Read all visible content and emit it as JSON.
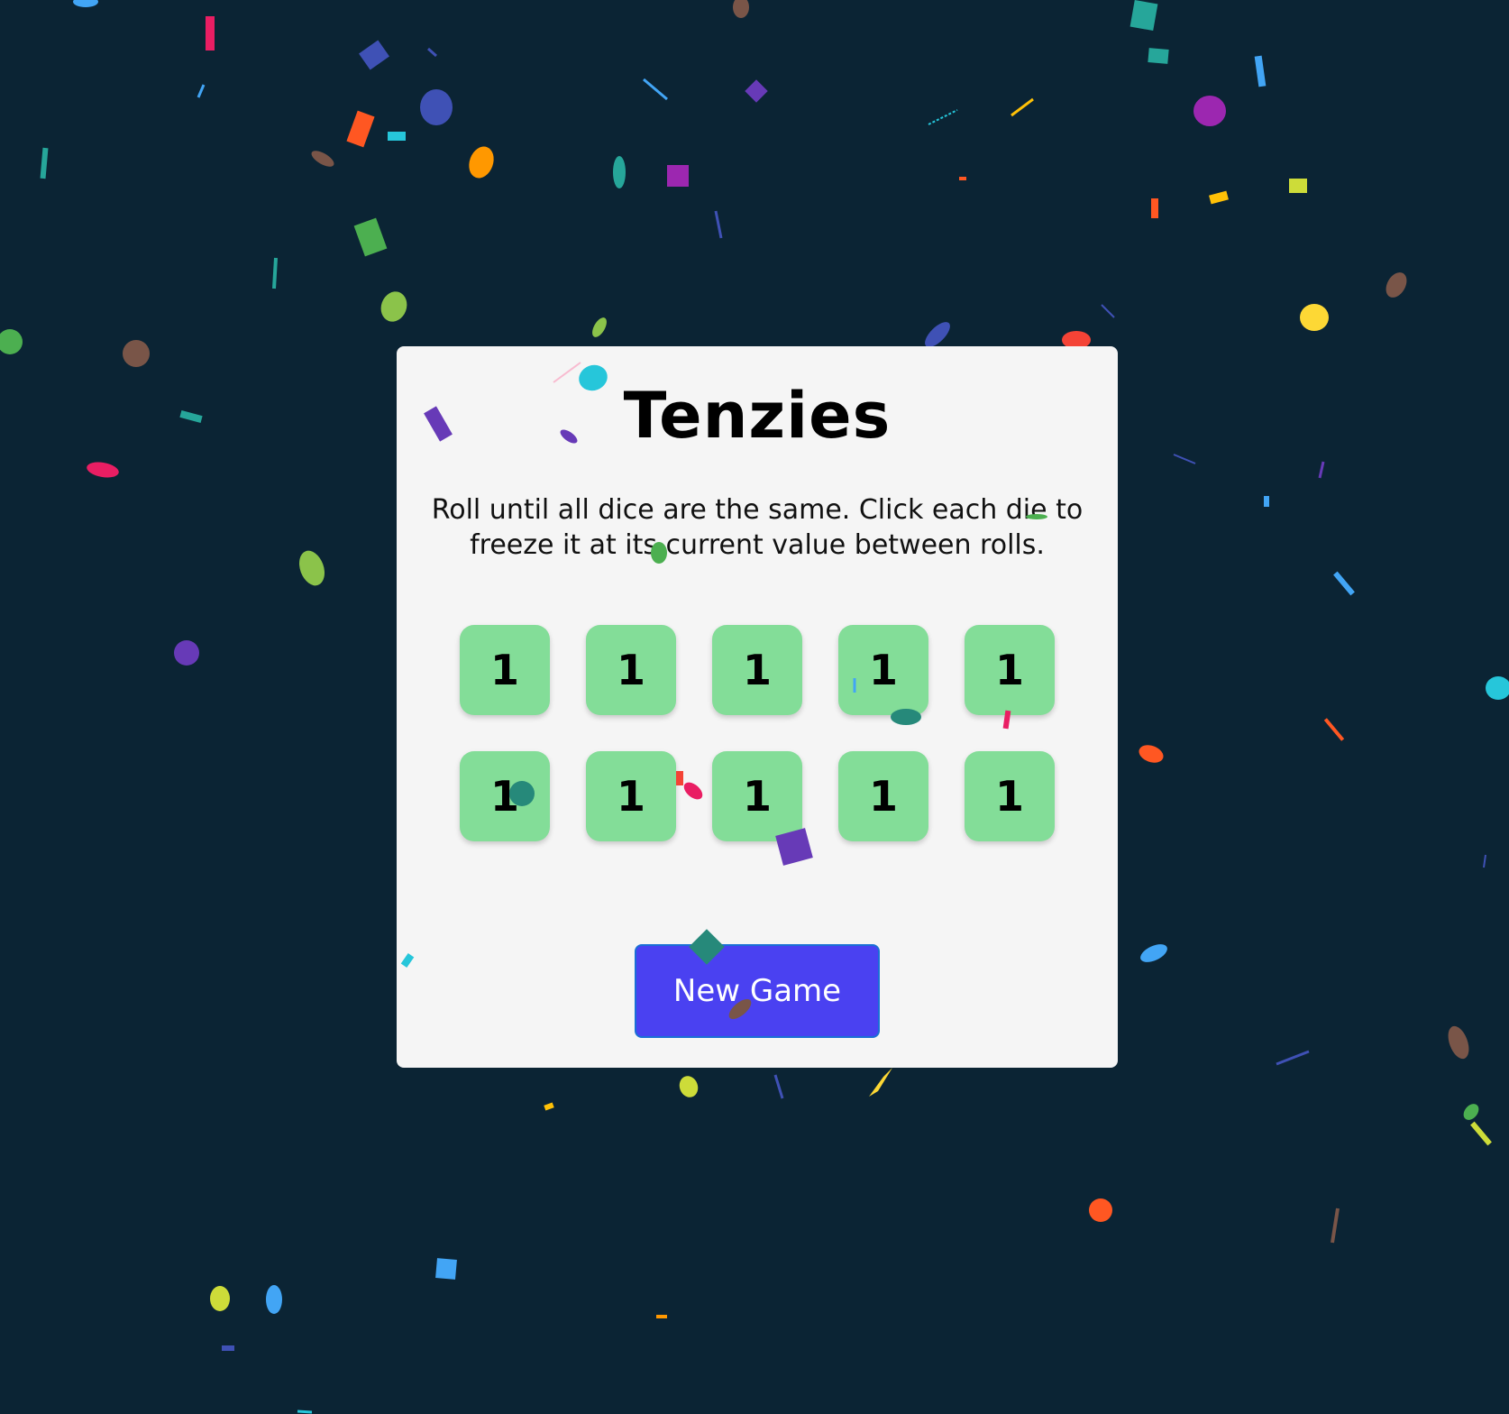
{
  "game": {
    "title": "Tenzies",
    "instructions": "Roll until all dice are the same. Click each die to freeze it at its current value between rolls.",
    "dice": [
      {
        "value": "1",
        "held": true
      },
      {
        "value": "1",
        "held": true
      },
      {
        "value": "1",
        "held": true
      },
      {
        "value": "1",
        "held": true
      },
      {
        "value": "1",
        "held": true
      },
      {
        "value": "1",
        "held": true
      },
      {
        "value": "1",
        "held": true
      },
      {
        "value": "1",
        "held": true
      },
      {
        "value": "1",
        "held": true
      },
      {
        "value": "1",
        "held": true
      }
    ],
    "button_label": "New Game",
    "won": true
  },
  "colors": {
    "background": "#0b2434",
    "board": "#f5f5f5",
    "die_held": "#83dd98",
    "button": "#4a41f1"
  }
}
